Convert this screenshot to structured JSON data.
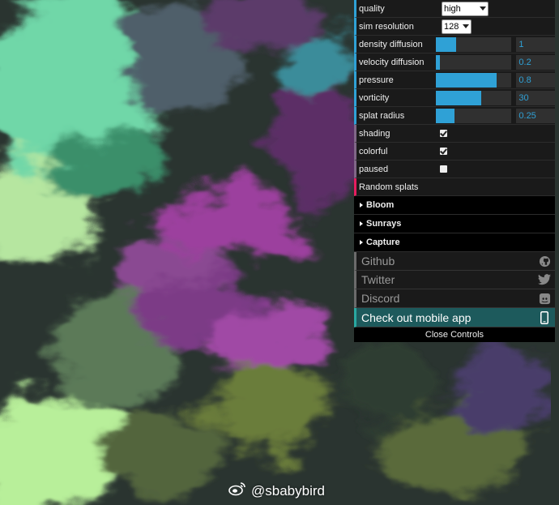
{
  "controls": {
    "quality": {
      "label": "quality",
      "value": "high"
    },
    "sim_resolution": {
      "label": "sim resolution",
      "value": "128"
    },
    "sliders": [
      {
        "label": "density diffusion",
        "value": "1",
        "fill": 0.27
      },
      {
        "label": "velocity diffusion",
        "value": "0.2",
        "fill": 0.05
      },
      {
        "label": "pressure",
        "value": "0.8",
        "fill": 0.8
      },
      {
        "label": "vorticity",
        "value": "30",
        "fill": 0.6
      },
      {
        "label": "splat radius",
        "value": "0.25",
        "fill": 0.24
      }
    ],
    "checkboxes": [
      {
        "label": "shading",
        "checked": true
      },
      {
        "label": "colorful",
        "checked": true
      },
      {
        "label": "paused",
        "checked": false
      }
    ],
    "random_splats": "Random splats",
    "folders": [
      "Bloom",
      "Sunrays",
      "Capture"
    ],
    "links": [
      {
        "label": "Github",
        "icon": "github-icon"
      },
      {
        "label": "Twitter",
        "icon": "twitter-icon"
      },
      {
        "label": "Discord",
        "icon": "discord-icon"
      }
    ],
    "mobile_app": {
      "label": "Check out mobile app",
      "icon": "phone-icon"
    },
    "close": "Close Controls"
  },
  "watermark": {
    "text": "@sbabybird",
    "icon": "weibo-icon"
  },
  "colors": {
    "accent": "#2fa1d6",
    "function": "#e61d5f",
    "boolean": "#806787",
    "app_bg": "#1d5a5c"
  }
}
